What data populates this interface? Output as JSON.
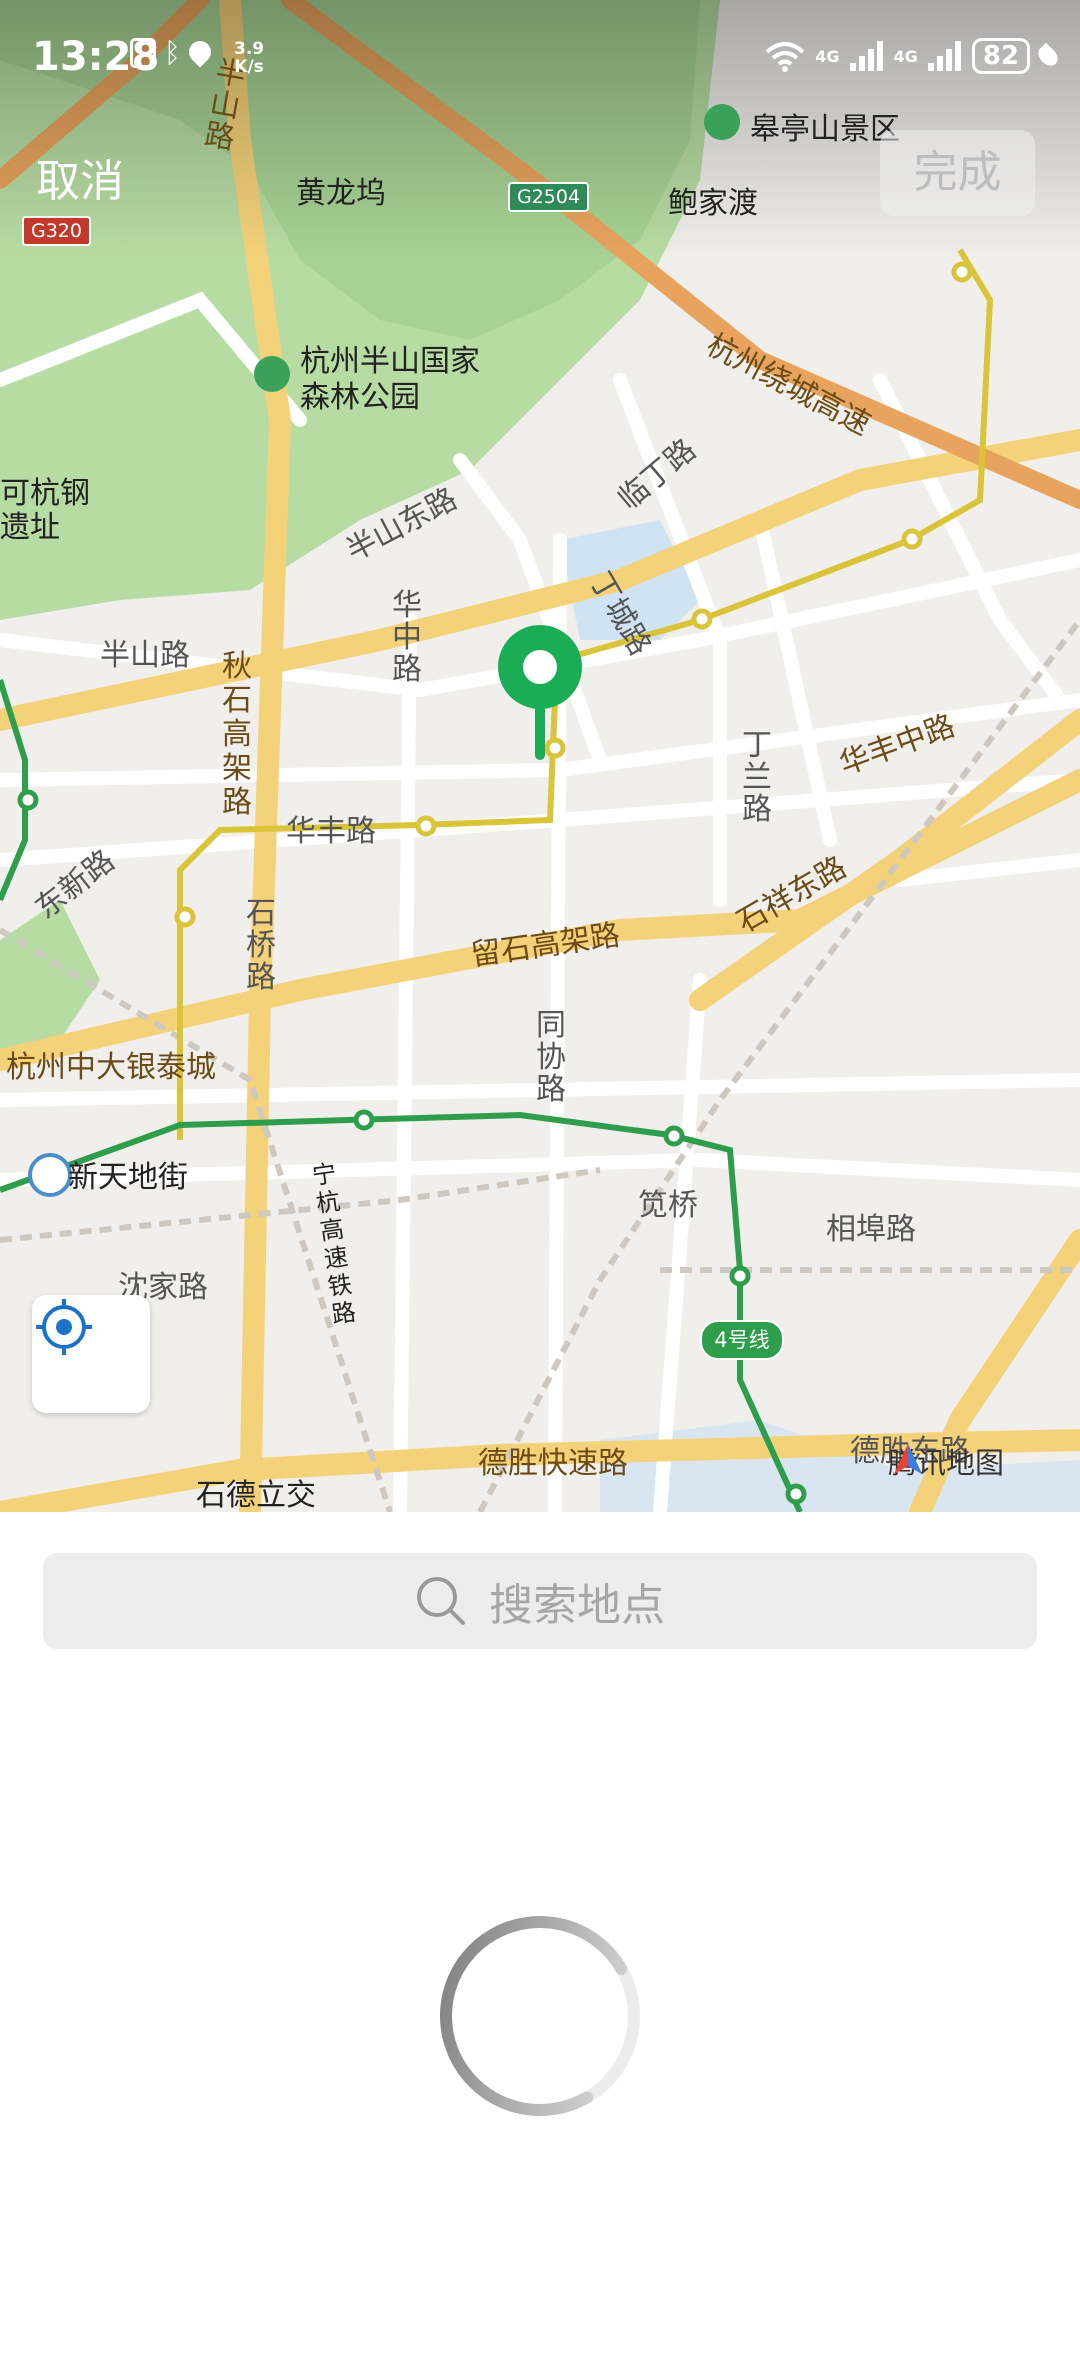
{
  "status_bar": {
    "time": "13:28",
    "net_speed": "3.9\nK/s",
    "signal1_label": "4G",
    "signal2_label": "4G",
    "battery": "82"
  },
  "header": {
    "cancel_label": "取消",
    "done_label": "完成"
  },
  "map": {
    "labels": {
      "huanglongwu": "黄龙坞",
      "baojiadu": "鲍家渡",
      "gaotingshan": "皋亭山景区",
      "banshan_park_1": "杭州半山国家",
      "banshan_park_2": "森林公园",
      "hangzhou_steel_1": "可杭钢",
      "hangzhou_steel_2": "遗址",
      "banshan_east_rd": "半山东路",
      "banshan_rd": "半山路",
      "huazhong_rd": "华中路",
      "qiushi_elevated": "秋石高架路",
      "linding_rd": "临丁路",
      "dingcheng_rd": "丁城路",
      "ringroad": "杭州绕城高速",
      "huafeng_rd": "华丰路",
      "dongxin_rd": "东新路",
      "dinglan_rd": "丁兰路",
      "huafeng_mid_rd": "华丰中路",
      "shixiang_east_rd": "石祥东路",
      "shiqiao_rd": "石桥路",
      "liushi_elevated": "留石高架路",
      "intime_mall": "杭州中大银泰城",
      "tongxie_rd": "同协路",
      "xintiandi": "新天地街",
      "ninghang_rail": "宁杭高速铁路",
      "jianqiao": "笕桥",
      "xiangfu_rd": "相埠路",
      "shenjia_rd": "沈家路",
      "desheng_expressway": "德胜快速路",
      "desheng_east": "德胜东路",
      "shide_interchange": "石德立交",
      "line4": "4号线",
      "shield_g320": "G320",
      "shield_g2504": "G2504",
      "banshan_vertical": "半山路"
    },
    "watermark": "腾讯地图",
    "pin_color": "#1aad55",
    "metro_green": "#2e9d4c",
    "metro_yellow": "#d9c43a"
  },
  "search": {
    "placeholder": "搜索地点"
  },
  "icons": {
    "pin": "map-pin-icon",
    "locate": "locate-icon",
    "search": "search-icon"
  }
}
